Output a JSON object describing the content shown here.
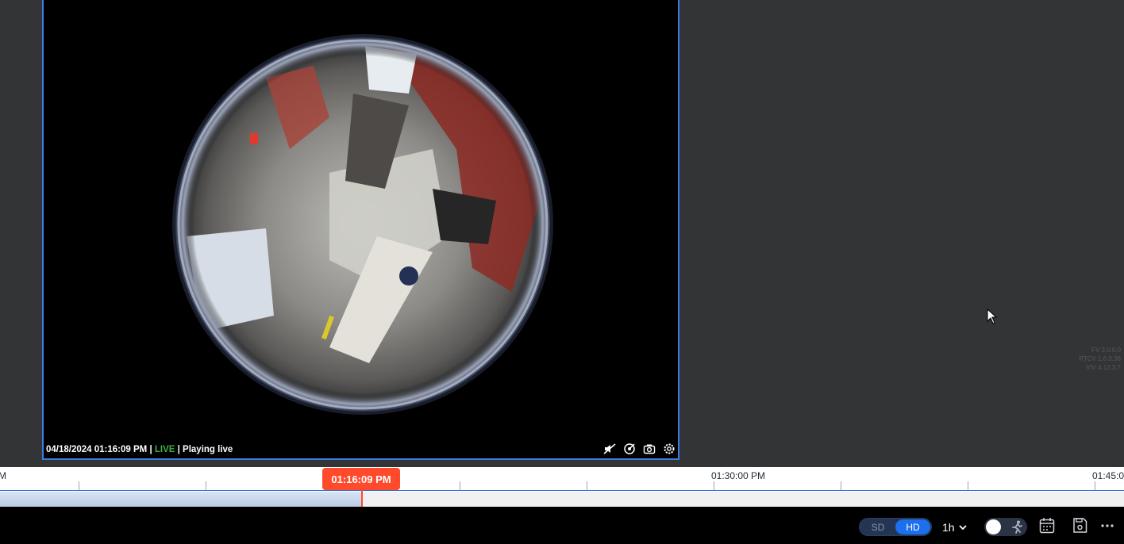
{
  "video": {
    "timestamp": "04/18/2024 01:16:09 PM",
    "separator": "|",
    "live_label": "LIVE",
    "status": "Playing live"
  },
  "version_info": [
    "FV 3.0.0.0",
    "RTCV 1.6.0.36",
    "VIV 4.12.3.7"
  ],
  "timeline": {
    "labels": [
      {
        "text": "M"
      },
      {
        "text": "01:30:00 PM"
      },
      {
        "text": "01:45:0"
      }
    ],
    "current_time": "01:16:09 PM"
  },
  "controls": {
    "sd_label": "SD",
    "hd_label": "HD",
    "selected_quality": "HD",
    "range_label": "1h"
  },
  "icons": [
    "mute-icon",
    "ptz-icon",
    "camera-snapshot-icon",
    "gear-icon",
    "chevron-down-icon",
    "running-person-icon",
    "calendar-icon",
    "save-clip-icon",
    "more-icon"
  ],
  "colors": {
    "accent": "#1c6fee",
    "playhead": "#ff4a2c",
    "live": "#3fae49",
    "tile_border": "#3a7ee6"
  }
}
